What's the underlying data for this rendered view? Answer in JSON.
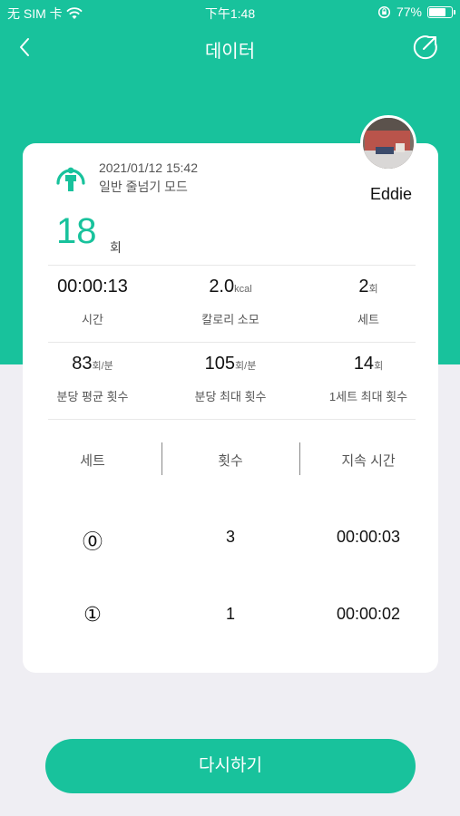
{
  "status_bar": {
    "carrier": "无 SIM 卡",
    "time": "下午1:48",
    "battery_percent": "77%",
    "battery_level": 0.77
  },
  "nav": {
    "title": "데이터",
    "back_icon": "chevron-left-icon",
    "share_icon": "share-icon"
  },
  "session": {
    "datetime": "2021/01/12 15:42",
    "mode": "일반 줄넘기 모드",
    "username": "Eddie",
    "total_count": "18",
    "total_unit": "회"
  },
  "stats_row1": [
    {
      "value": "00:00:13",
      "unit": "",
      "label": "시간"
    },
    {
      "value": "2.0",
      "unit": "kcal",
      "label": "칼로리 소모"
    },
    {
      "value": "2",
      "unit": "회",
      "label": "세트"
    }
  ],
  "stats_row2": [
    {
      "value": "83",
      "unit": "회/분",
      "label": "분당 평균 횟수"
    },
    {
      "value": "105",
      "unit": "회/분",
      "label": "분당 최대 횟수"
    },
    {
      "value": "14",
      "unit": "회",
      "label": "1세트 최대 횟수"
    }
  ],
  "table": {
    "headers": [
      "세트",
      "횟수",
      "지속 시간"
    ],
    "rows": [
      {
        "set": "⓪",
        "count": "3",
        "duration": "00:00:03"
      },
      {
        "set": "①",
        "count": "1",
        "duration": "00:00:02"
      }
    ]
  },
  "retry_button": "다시하기",
  "colors": {
    "accent": "#18c29c",
    "background": "#efeef3"
  }
}
